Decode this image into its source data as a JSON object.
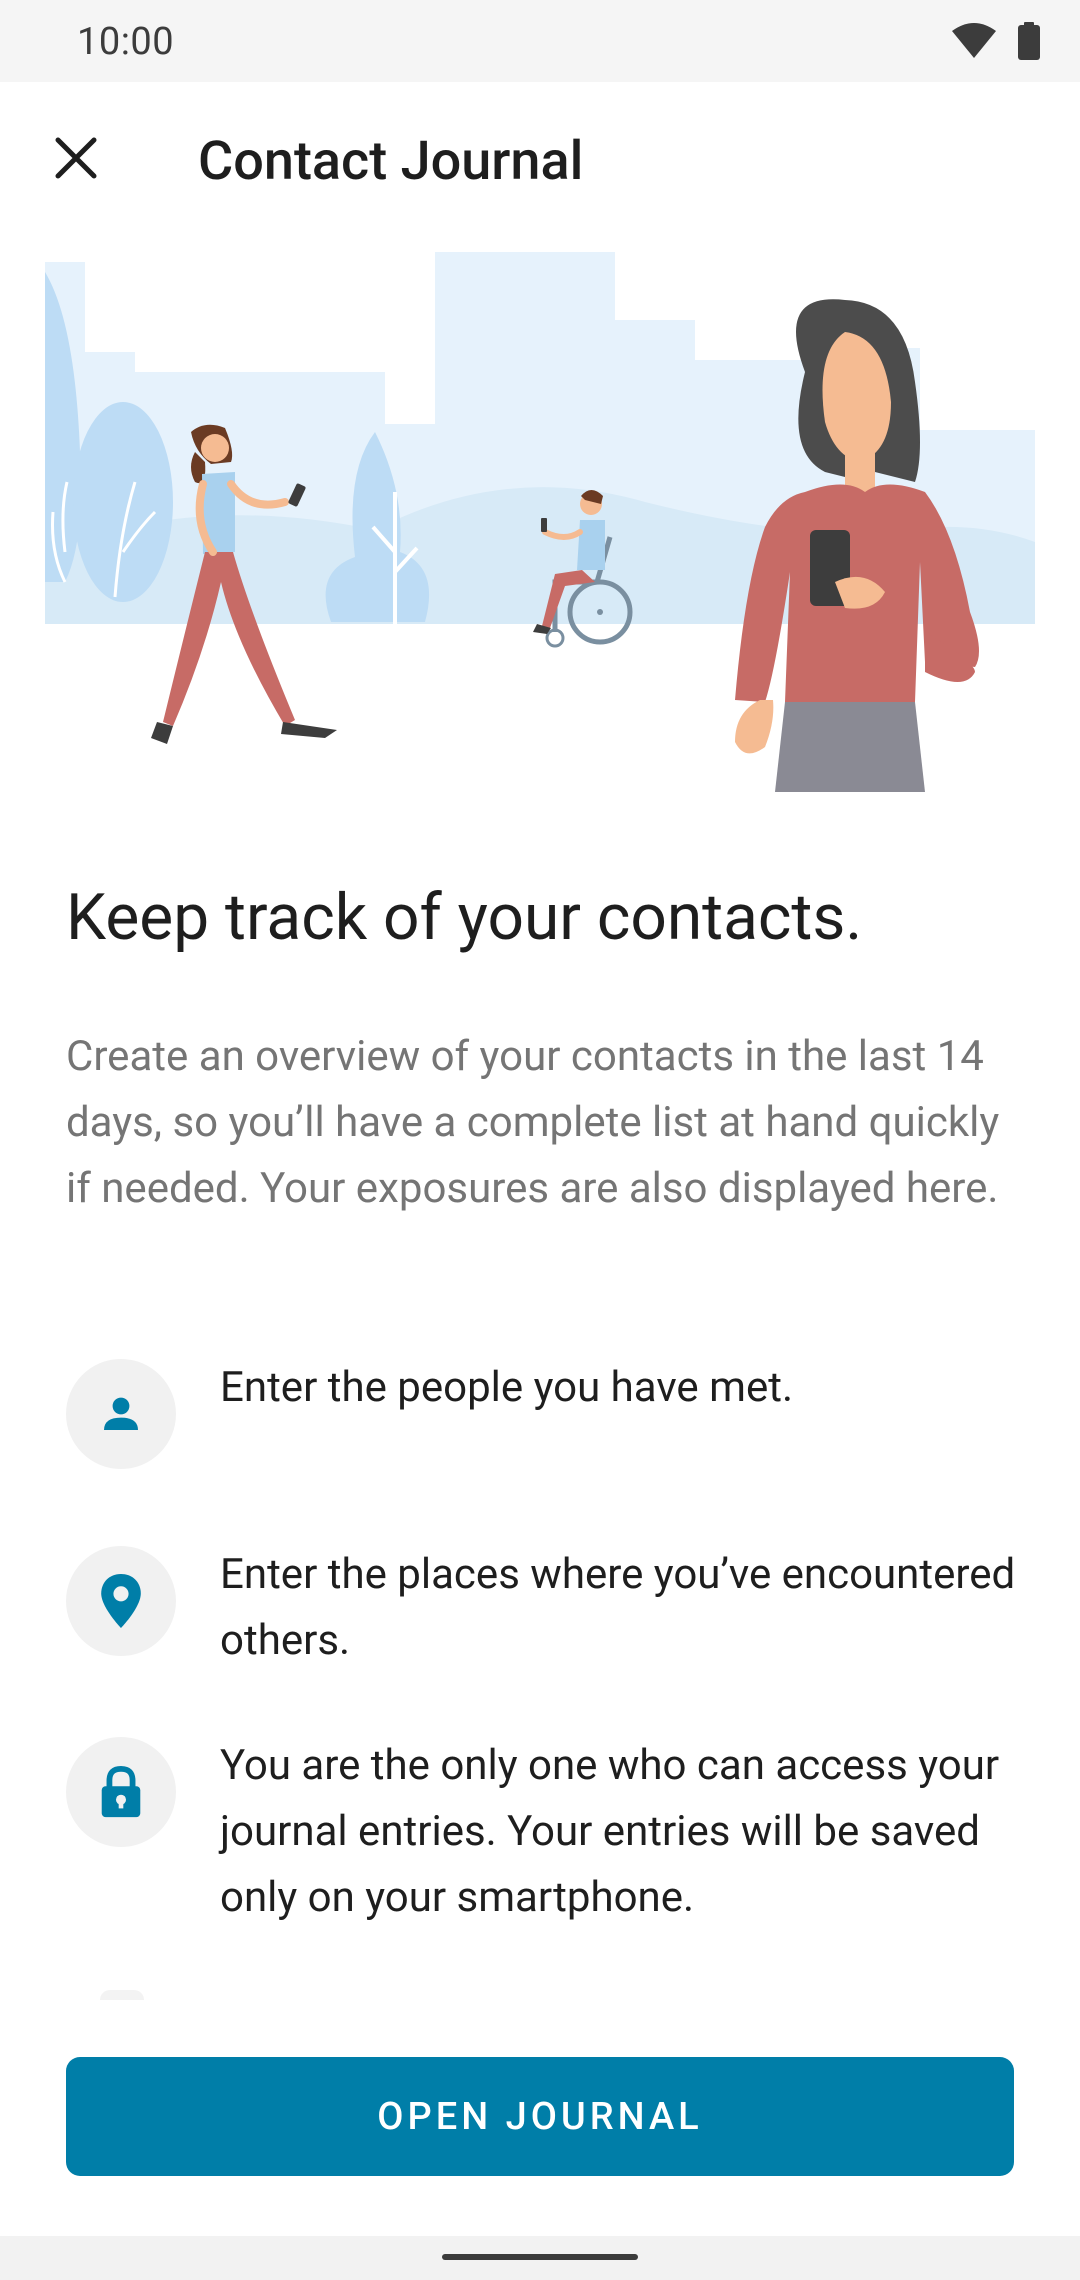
{
  "status_bar": {
    "time": "10:00"
  },
  "toolbar": {
    "title": "Contact Journal"
  },
  "intro": {
    "headline": "Keep track of your contacts.",
    "body": "Create an overview of your contacts in the last 14 days, so you’ll have a complete list at hand quickly if needed. Your exposures are also displayed here."
  },
  "features": [
    {
      "icon": "person-icon",
      "text": "Enter the people you have met."
    },
    {
      "icon": "location-pin-icon",
      "text": "Enter the places where you’ve encountered others."
    },
    {
      "icon": "lock-icon",
      "text": "You are the only one who can access your journal entries. Your entries will be saved only on your smartphone."
    }
  ],
  "button": {
    "label": "OPEN JOURNAL"
  },
  "colors": {
    "accent": "#007ea8",
    "icon_tint": "#007ea8",
    "icon_bg": "#f1f1f1"
  }
}
